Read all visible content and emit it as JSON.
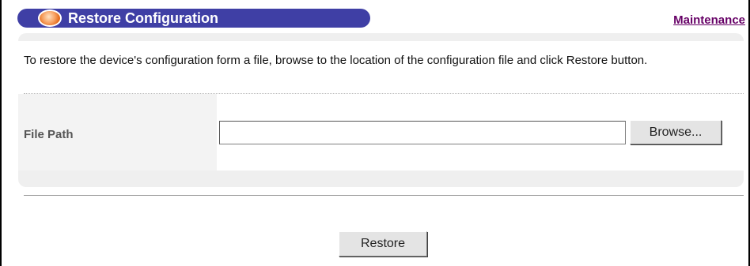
{
  "header": {
    "title": "Restore Configuration",
    "link_label": "Maintenance",
    "bar_color": "#3f3fa5",
    "icon": "orange-orb-icon"
  },
  "intro_text": "To restore the device's configuration form a file, browse to the location of the configuration file and click Restore button.",
  "file_path": {
    "label": "File Path",
    "value": "",
    "browse_label": "Browse..."
  },
  "actions": {
    "restore_label": "Restore"
  }
}
